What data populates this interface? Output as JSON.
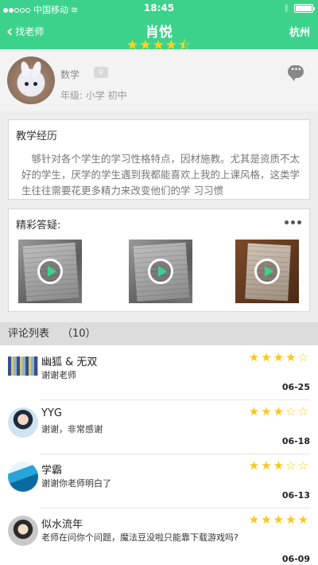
{
  "status_bar": {
    "carrier": "中国移动",
    "time": "18:45"
  },
  "nav": {
    "back_label": "找老师",
    "title": "肖悦",
    "rating_stars": "★★★★⯪",
    "rating": 4.5,
    "city": "杭州"
  },
  "profile": {
    "subject": "数学",
    "grade": "年级: 小学 初中"
  },
  "experience": {
    "title": "教学经历",
    "text": "够针对各个学生的学习性格特点，因材施教。尤其是资质不太好的学生，厌学的学生遇到我都能喜欢上我的上课风格，这类学生往往需要花更多精力来改变他们的学 习习惯"
  },
  "answers": {
    "title": "精彩答疑:"
  },
  "comments_header": {
    "label": "评论列表",
    "count": "（10）"
  },
  "comments": [
    {
      "name": "幽狐 & 无双",
      "text": "谢谢老师",
      "stars": "★★★★☆",
      "rating": 4,
      "date": "06-25"
    },
    {
      "name": "YYG",
      "text": "谢谢，非常感谢",
      "stars": "★★★☆☆",
      "rating": 3,
      "date": "06-18"
    },
    {
      "name": "学霸",
      "text": "谢谢你老师明白了",
      "stars": "★★★☆☆",
      "rating": 3,
      "date": "06-13"
    },
    {
      "name": "似水流年",
      "text": "老师在问你个问题，魔法豆没啦只能靠下载游戏吗?",
      "stars": "★★★★★",
      "rating": 5,
      "date": "06-09"
    }
  ],
  "colors": {
    "brand_green": "#3dd28b",
    "star_yellow": "#ffc61a"
  }
}
